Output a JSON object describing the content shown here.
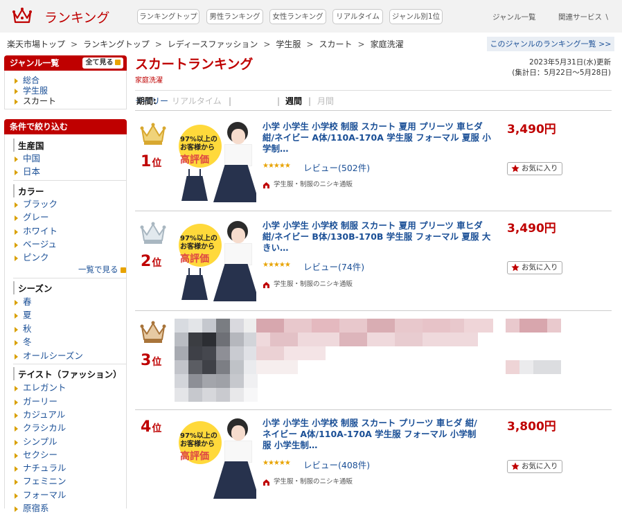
{
  "header": {
    "logo_text": "ランキング",
    "nav_buttons": [
      "ランキングトップ",
      "男性ランキング",
      "女性ランキング",
      "リアルタイム",
      "ジャンル別1位"
    ],
    "genre_list_link": "ジャンル一覧",
    "related_services": "関連サービス ∖"
  },
  "breadcrumbs": [
    "楽天市場トップ",
    "ランキングトップ",
    "レディースファッション",
    "学生服",
    "スカート",
    "家庭洗濯"
  ],
  "breadcrumb_separator": ">",
  "genre_ranking_list_btn": "このジャンルのランキング一覧 >>",
  "sidebar": {
    "genre_title": "ジャンル一覧",
    "show_all_btn": "全て見る",
    "genres": [
      "総合",
      "学生服",
      "スカート"
    ],
    "filter_title": "条件で絞り込む",
    "groups": [
      {
        "title": "生産国",
        "items": [
          "中国",
          "日本"
        ]
      },
      {
        "title": "カラー",
        "items": [
          "ブラック",
          "グレー",
          "ホワイト",
          "ベージュ",
          "ピンク"
        ],
        "more": "一覧で見る"
      },
      {
        "title": "シーズン",
        "items": [
          "春",
          "夏",
          "秋",
          "冬",
          "オールシーズン"
        ]
      },
      {
        "title": "テイスト（ファッション）",
        "items": [
          "エレガント",
          "ガーリー",
          "カジュアル",
          "クラシカル",
          "シンプル",
          "セクシー",
          "ナチュラル",
          "フェミニン",
          "フォーマル",
          "原宿系"
        ]
      }
    ]
  },
  "main": {
    "title": "スカートランキング",
    "subtitle": "家庭洗濯",
    "updated": "2023年5月31日(水)更新",
    "period_summary": "(集計日：5月22日～5月28日)",
    "period_label": "期間:",
    "periods": [
      "リアルタイム",
      "デイリー",
      "週間",
      "月間"
    ],
    "period_sep": "|"
  },
  "items": [
    {
      "rank": "1",
      "rank_suffix": "位",
      "title": "小学 小学生 小学校 制服 スカート 夏用 プリーツ 車ヒダ 紺/ネイビー A体/110A-170A 学生服 フォーマル 夏服 小学制…",
      "stars": "★★★★★",
      "reviews": "レビュー(502件)",
      "shop": "学生服・制服のニシキ通販",
      "price": "3,490円",
      "fav": "お気に入り",
      "thumb_badge_1": "97%以上の",
      "thumb_badge_2": "お客様から",
      "thumb_badge_3": "高評価"
    },
    {
      "rank": "2",
      "rank_suffix": "位",
      "title": "小学 小学生 小学校 制服 スカート 夏用 プリーツ 車ヒダ 紺/ネイビー B体/130B-170B 学生服 フォーマル 夏服 大きい…",
      "stars": "★★★★★",
      "reviews": "レビュー(74件)",
      "shop": "学生服・制服のニシキ通販",
      "price": "3,490円",
      "fav": "お気に入り",
      "thumb_badge_1": "97%以上の",
      "thumb_badge_2": "お客様から",
      "thumb_badge_3": "高評価"
    },
    {
      "rank": "3",
      "rank_suffix": "位"
    },
    {
      "rank": "4",
      "rank_suffix": "位",
      "title": "小学 小学生 小学校 制服 スカート プリーツ 車ヒダ 紺/ネイビー A体/110A-170A 学生服 フォーマル 小学制服 小学生制…",
      "stars": "★★★★★",
      "reviews": "レビュー(408件)",
      "shop": "学生服・制服のニシキ通販",
      "price": "3,800円",
      "fav": "お気に入り",
      "thumb_badge_1": "97%以上の",
      "thumb_badge_2": "お客様から",
      "thumb_badge_3": "高評価"
    }
  ],
  "colors": {
    "brand": "#bf0000",
    "link": "#1a4f96",
    "gold": "#e8a300",
    "silver": "#b8c4cc",
    "bronze": "#b07a3a"
  }
}
